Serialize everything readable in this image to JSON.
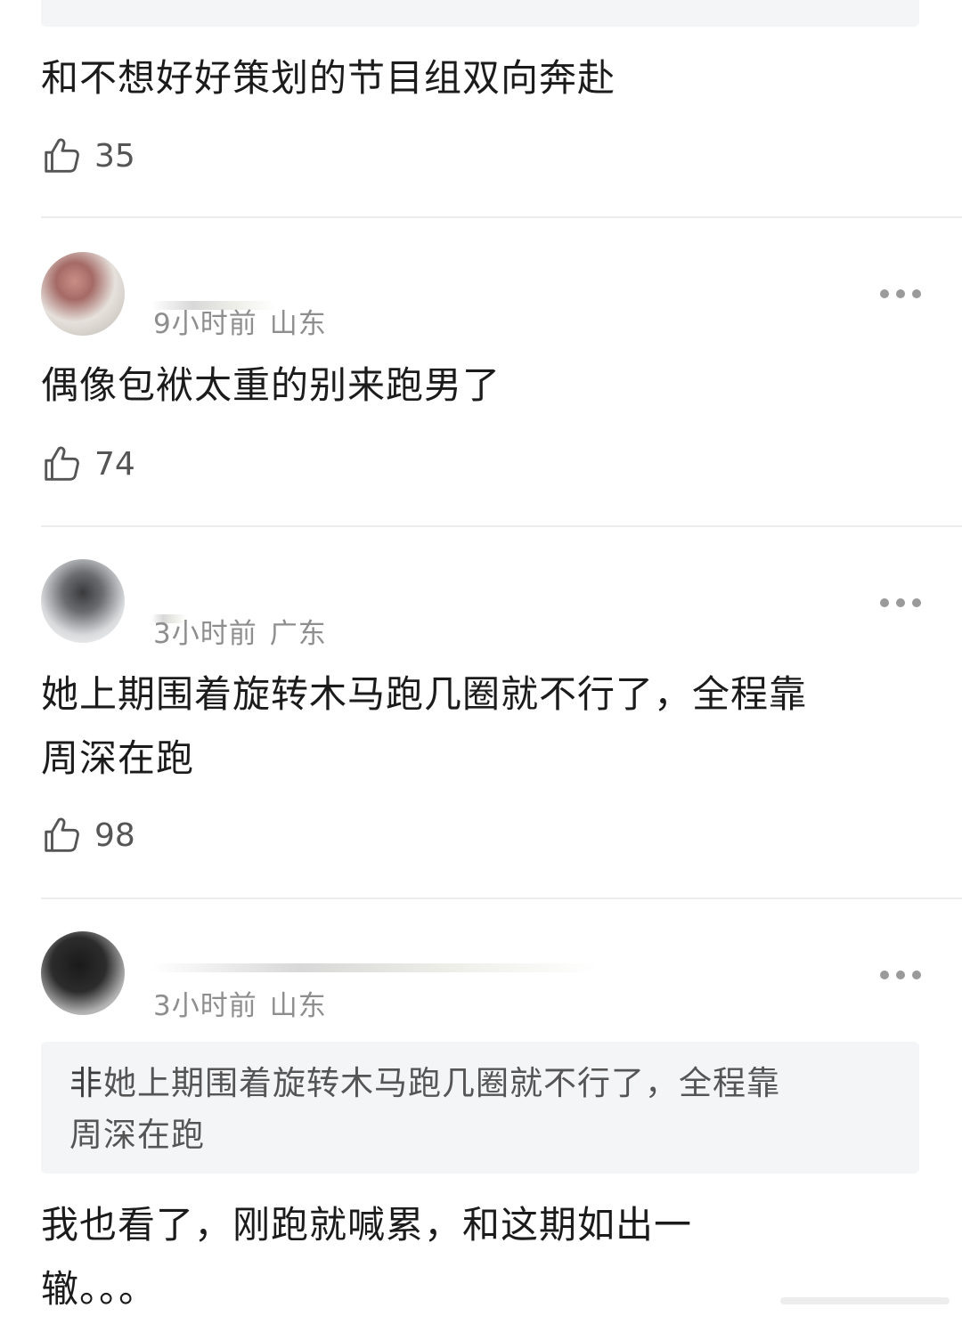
{
  "comments": [
    {
      "text": "和不想好好策划的节目组双向奔赴",
      "likes": "35"
    },
    {
      "meta_time": "9小时前",
      "meta_location": "山东",
      "text": "偶像包袱太重的别来跑男了",
      "likes": "74"
    },
    {
      "meta_time": "3小时前",
      "meta_location": "广东",
      "text_line1": "她上期围着旋转木马跑几圈就不行了，全程靠",
      "text_line2": "周深在跑",
      "likes": "98"
    },
    {
      "meta_time": "3小时前",
      "meta_location": "山东",
      "quote_author": "非",
      "quote_line1": "她上期围着旋转木马跑几圈就不行了，全程靠",
      "quote_line2": "周深在跑",
      "text_line1": "我也看了，刚跑就喊累，和这期如出一",
      "text_line2": "辙。。。"
    }
  ],
  "icons": {
    "like": "thumbs-up-icon",
    "more": "more-dots-icon"
  },
  "colors": {
    "text": "#1b1b1b",
    "meta": "#8e8e8e",
    "divider": "#ececec",
    "quote_bg": "#f4f5f7",
    "icon": "#555555"
  }
}
